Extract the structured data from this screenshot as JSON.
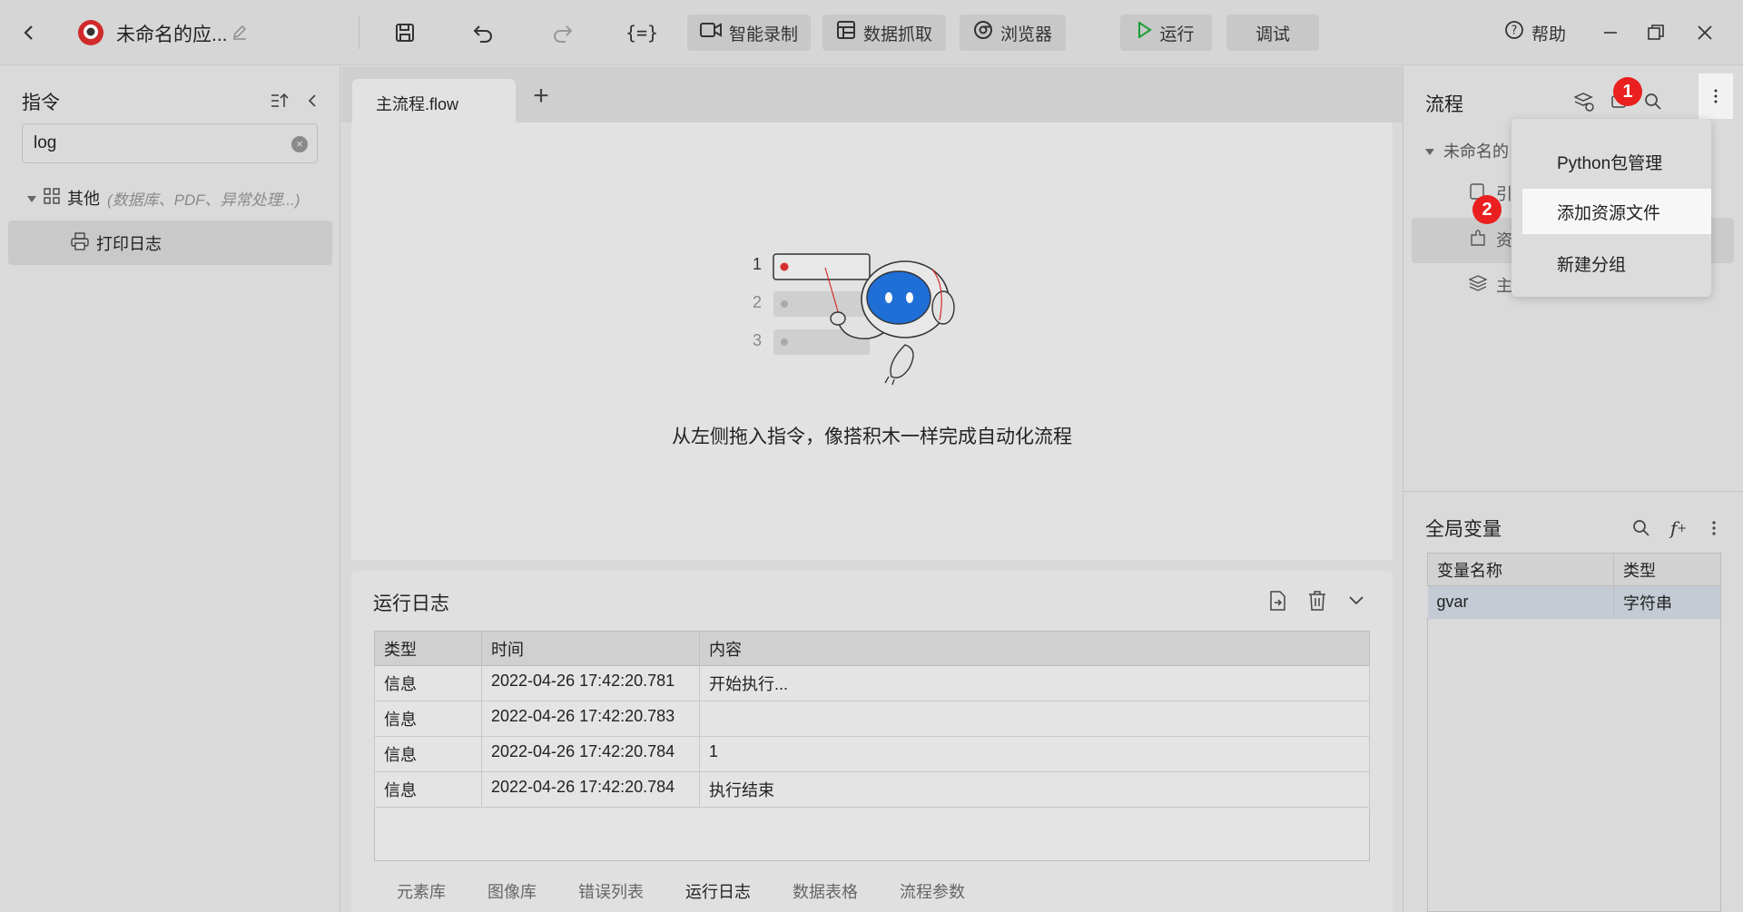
{
  "titlebar": {
    "app_title": "未命名的应...",
    "buttons": {
      "record": "智能录制",
      "scrape": "数据抓取",
      "browser": "浏览器",
      "run": "运行",
      "debug": "调试",
      "help": "帮助"
    }
  },
  "left_panel": {
    "title": "指令",
    "search_value": "log",
    "category_label": "其他",
    "category_hint": "(数据库、PDF、异常处理...)",
    "result_item": "打印日志"
  },
  "editor": {
    "tab_label": "主流程.flow",
    "empty_message": "从左侧拖入指令，像搭积木一样完成自动化流程",
    "illustration_rows": [
      "1",
      "2",
      "3"
    ]
  },
  "run_log": {
    "title": "运行日志",
    "columns": [
      "类型",
      "时间",
      "内容"
    ],
    "rows": [
      {
        "type": "信息",
        "time": "2022-04-26 17:42:20.781",
        "content": "开始执行..."
      },
      {
        "type": "信息",
        "time": "2022-04-26 17:42:20.783",
        "content": ""
      },
      {
        "type": "信息",
        "time": "2022-04-26 17:42:20.784",
        "content": "1"
      },
      {
        "type": "信息",
        "time": "2022-04-26 17:42:20.784",
        "content": "执行结束"
      }
    ],
    "bottom_tabs": [
      "元素库",
      "图像库",
      "错误列表",
      "运行日志",
      "数据表格",
      "流程参数"
    ],
    "active_tab": "运行日志"
  },
  "flow_panel": {
    "title": "流程",
    "root_node": "未命名的",
    "children": [
      "引",
      "资",
      "主"
    ]
  },
  "context_menu": {
    "items": [
      "Python包管理",
      "添加资源文件",
      "新建分组"
    ],
    "hovered": "添加资源文件"
  },
  "badges": {
    "first": "1",
    "second": "2"
  },
  "global_vars": {
    "title": "全局变量",
    "columns": [
      "变量名称",
      "类型"
    ],
    "rows": [
      {
        "name": "gvar",
        "type": "字符串"
      }
    ]
  },
  "colors": {
    "accent_red": "#ea1f1f",
    "run_green": "#1e9e3a",
    "robot_blue": "#1f6fd6"
  }
}
